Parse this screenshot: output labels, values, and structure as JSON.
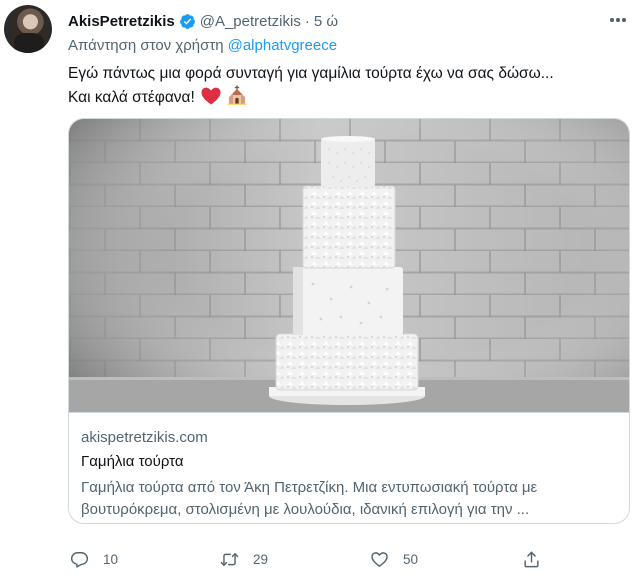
{
  "tweet": {
    "author_name": "AkisPetretzikis",
    "author_handle": "@A_petretzikis",
    "separator": "·",
    "time": "5 ώ",
    "reply_to_prefix": "Απάντηση στον χρήστη",
    "reply_to_handle": "@alphatvgreece",
    "text_line1": "Εγώ πάντως μια φορά συνταγή για γαμίλια τούρτα έχω να σας δώσω...",
    "text_line2": "Και καλά στέφανα!",
    "emojis": [
      "red-heart",
      "wedding-chapel"
    ]
  },
  "card": {
    "image_subject": "wedding-cake",
    "domain": "akispetretzikis.com",
    "title": "Γαμήλια τούρτα",
    "description_line1": "Γαμήλια τούρτα από τον Άκη Πετρετζίκη. Μια εντυπωσιακή τούρτα με",
    "description_line2": "βουτυρόκρεμα, στολισμένη με λουλούδια, ιδανική επιλογή για την ..."
  },
  "actions": {
    "reply_count": "10",
    "retweet_count": "29",
    "like_count": "50"
  },
  "colors": {
    "accent": "#1d9bf0",
    "secondary_text": "#536471",
    "primary_text": "#0f1419",
    "border": "#cfd9de",
    "heart": "#e0245e"
  }
}
